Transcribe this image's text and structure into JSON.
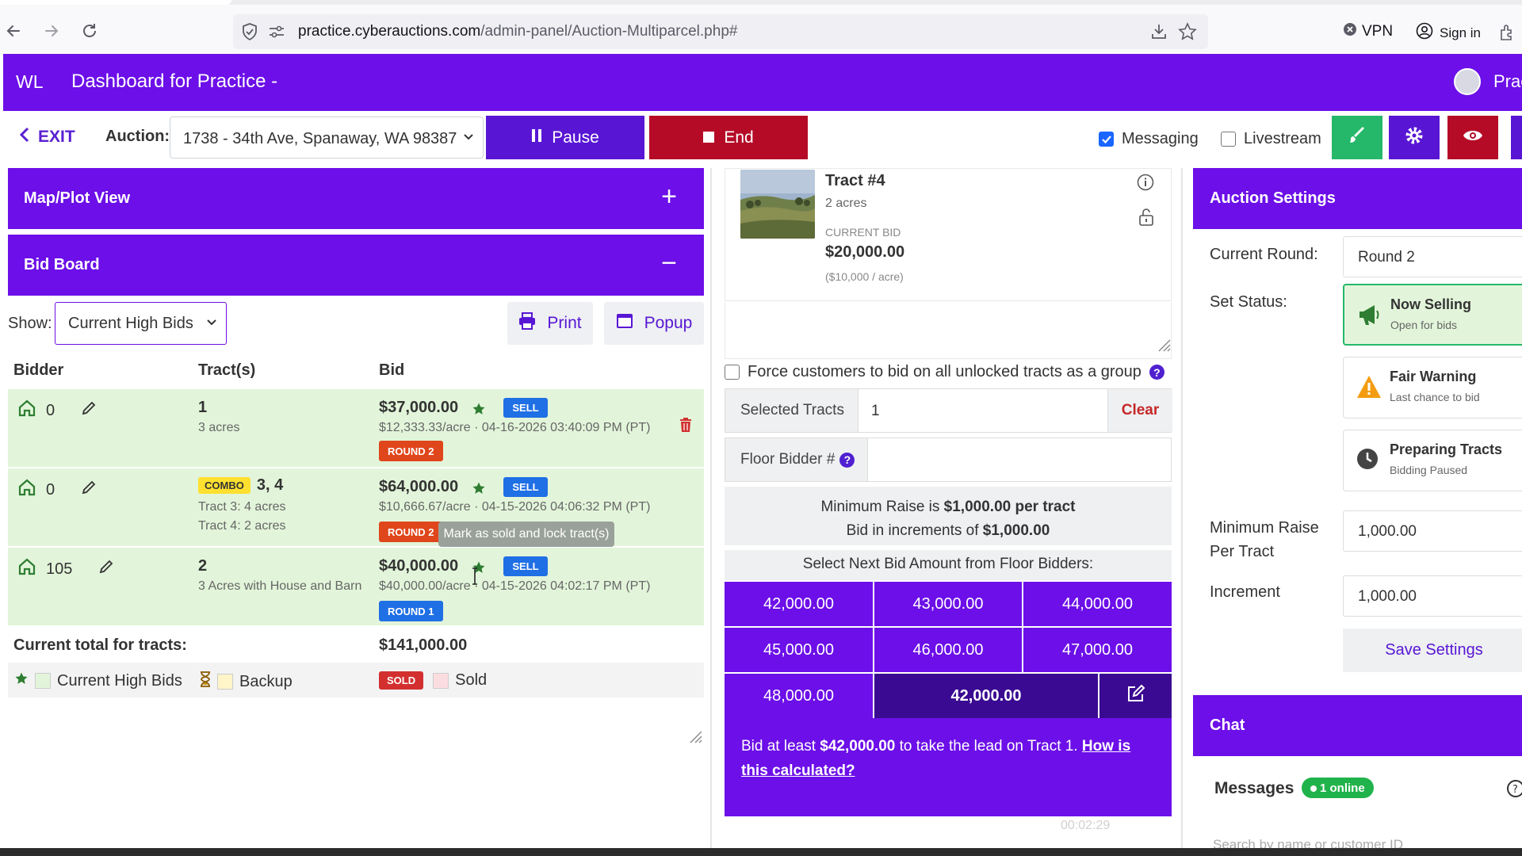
{
  "browser": {
    "url_domain": "practice.cyberauctions.com",
    "url_path": "/admin-panel/Auction-Multiparcel.php#",
    "vpn_label": "VPN",
    "signin_label": "Sign in"
  },
  "appbar": {
    "logo": "WL",
    "title": "Dashboard for Practice -",
    "account_label": "Prac"
  },
  "toolbar": {
    "exit_label": "EXIT",
    "auction_label": "Auction:",
    "auction_value": "1738 - 34th Ave, Spanaway, WA 98387",
    "pause_label": "Pause",
    "end_label": "End",
    "messaging_label": "Messaging",
    "messaging_checked": true,
    "livestream_label": "Livestream",
    "livestream_checked": false
  },
  "left": {
    "map_title": "Map/Plot View",
    "map_symbol": "+",
    "bidboard_title": "Bid Board",
    "bidboard_symbol": "−",
    "show_label": "Show:",
    "show_value": "Current High Bids",
    "print_label": "Print",
    "popup_label": "Popup",
    "columns": {
      "bidder": "Bidder",
      "tracts": "Tract(s)",
      "bid": "Bid"
    },
    "rows": [
      {
        "bidder": "0",
        "tract": "1",
        "combo": "",
        "tract_sub": [
          "3 acres"
        ],
        "bid": "$37,000.00",
        "bid_sub": "$12,333.33/acre · 04-16-2026 03:40:09 PM (PT)",
        "sell": "SELL",
        "round": "ROUND 2"
      },
      {
        "bidder": "0",
        "tract": "3, 4",
        "combo": "COMBO",
        "tract_sub": [
          "Tract 3: 4 acres",
          "Tract 4: 2 acres"
        ],
        "bid": "$64,000.00",
        "bid_sub": "$10,666.67/acre · 04-15-2026 04:06:32 PM (PT)",
        "sell": "SELL",
        "round": "ROUND 2"
      },
      {
        "bidder": "105",
        "tract": "2",
        "combo": "",
        "tract_sub": [
          "3 Acres with House and Barn"
        ],
        "bid": "$40,000.00",
        "bid_sub": "$40,000.00/acre · 04-15-2026 04:02:17 PM (PT)",
        "sell": "SELL",
        "round": "ROUND 1"
      }
    ],
    "tooltip": "Mark as sold and lock tract(s)",
    "total_label": "Current total for tracts:",
    "total_value": "$141,000.00",
    "legend": {
      "high": "Current High Bids",
      "backup": "Backup",
      "sold_badge": "SOLD",
      "sold": "Sold"
    }
  },
  "center": {
    "tract_title": "Tract #4",
    "tract_acres": "2 acres",
    "current_bid_label": "CURRENT BID",
    "current_bid": "$20,000.00",
    "per_acre": "($10,000 / acre)",
    "force_label": "Force customers to bid on all unlocked tracts as a group",
    "selected_label": "Selected Tracts",
    "selected_value": "1",
    "clear_label": "Clear",
    "floor_label": "Floor Bidder #",
    "min_raise_pre": "Minimum Raise is ",
    "min_raise_val": "$1,000.00 per tract",
    "increment_pre": "Bid in increments of ",
    "increment_val": "$1,000.00",
    "select_next": "Select Next Bid Amount from Floor Bidders:",
    "amounts": [
      "42,000.00",
      "43,000.00",
      "44,000.00",
      "45,000.00",
      "46,000.00",
      "47,000.00",
      "48,000.00"
    ],
    "custom_amount": "42,000.00",
    "bid_info_pre": "Bid at least ",
    "bid_info_amt": "$42,000.00",
    "bid_info_post": " to take the lead on Tract 1. ",
    "bid_info_link": "How is this calculated?",
    "timer": "00:02:29"
  },
  "right": {
    "settings_title": "Auction Settings",
    "current_round_label": "Current Round:",
    "current_round_value": "Round 2",
    "set_status_label": "Set Status:",
    "statuses": [
      {
        "title": "Now Selling",
        "sub": "Open for bids"
      },
      {
        "title": "Fair Warning",
        "sub": "Last chance to bid"
      },
      {
        "title": "Preparing Tracts",
        "sub": "Bidding Paused"
      }
    ],
    "min_raise_label_1": "Minimum Raise",
    "min_raise_label_2": "Per Tract",
    "min_raise_value": "1,000.00",
    "increment_label": "Increment",
    "increment_value": "1,000.00",
    "save_label": "Save Settings",
    "chat_title": "Chat",
    "messages_label": "Messages",
    "online_label": "1 online",
    "search_placeholder": "Search by name or customer ID"
  },
  "colors": {
    "primary": "#6c0fe8",
    "danger": "#b50b27",
    "success_bg": "#e2f5da",
    "sell": "#1f6fe5",
    "round2": "#e0461b",
    "round1": "#1f6fe5"
  }
}
